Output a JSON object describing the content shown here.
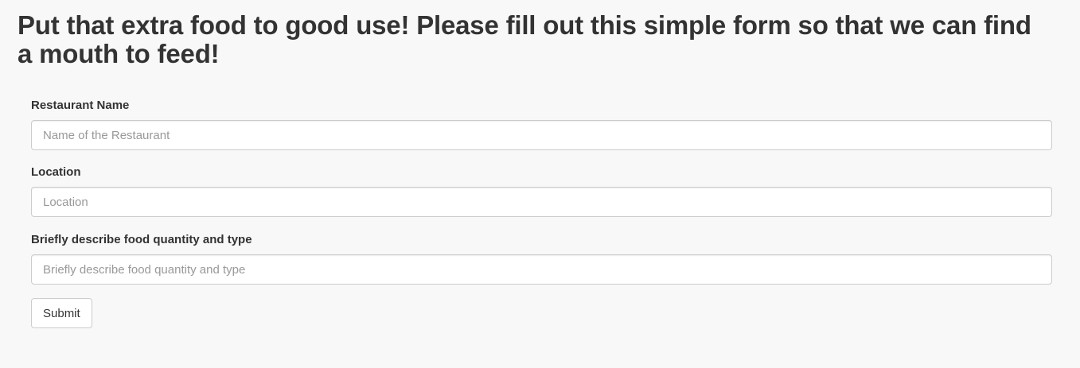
{
  "heading": "Put that extra food to good use! Please fill out this simple form so that we can find a mouth to feed!",
  "form": {
    "fields": [
      {
        "label": "Restaurant Name",
        "placeholder": "Name of the Restaurant",
        "value": ""
      },
      {
        "label": "Location",
        "placeholder": "Location",
        "value": ""
      },
      {
        "label": "Briefly describe food quantity and type",
        "placeholder": "Briefly describe food quantity and type",
        "value": ""
      }
    ],
    "submit_label": "Submit"
  },
  "colors": {
    "background": "#f8f8f8",
    "text": "#333333",
    "placeholder": "#999999",
    "border": "#cccccc",
    "input_background": "#ffffff"
  }
}
